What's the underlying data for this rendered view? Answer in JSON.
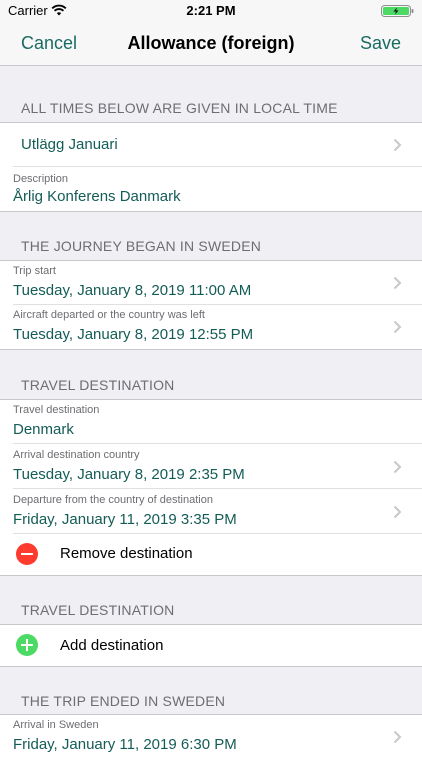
{
  "status_bar": {
    "carrier": "Carrier",
    "time": "2:21 PM"
  },
  "nav": {
    "cancel": "Cancel",
    "title": "Allowance (foreign)",
    "save": "Save"
  },
  "sections": {
    "intro": {
      "header": "ALL TIMES BELOW ARE GIVEN IN LOCAL TIME",
      "template_value": "Utlägg Januari",
      "description_label": "Description",
      "description_value": "Årlig Konferens Danmark"
    },
    "journey_began": {
      "header": "THE JOURNEY BEGAN IN SWEDEN",
      "trip_start_label": "Trip start",
      "trip_start_value": "Tuesday, January 8, 2019 11:00 AM",
      "departed_label": "Aircraft departed or the country was left",
      "departed_value": "Tuesday, January 8, 2019 12:55 PM"
    },
    "destination1": {
      "header": "TRAVEL DESTINATION",
      "destination_label": "Travel destination",
      "destination_value": "Denmark",
      "arrival_label": "Arrival destination country",
      "arrival_value": "Tuesday, January 8, 2019 2:35 PM",
      "departure_label": "Departure from the country of destination",
      "departure_value": "Friday, January 11, 2019 3:35 PM",
      "remove_label": "Remove destination"
    },
    "destination2": {
      "header": "TRAVEL DESTINATION",
      "add_label": "Add destination"
    },
    "trip_ended": {
      "header": "THE TRIP ENDED IN SWEDEN",
      "arrival_label": "Arrival in Sweden",
      "arrival_value": "Friday, January 11, 2019 6:30 PM"
    }
  },
  "colors": {
    "accent": "#145c56",
    "remove": "#ff3b30",
    "add": "#4cd964",
    "background": "#efeff4"
  }
}
